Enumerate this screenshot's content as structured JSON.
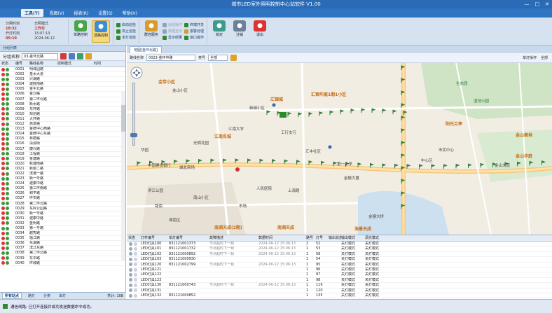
{
  "titlebar": {
    "title": "城市LED室外照明控制中心站软件  V1.00",
    "controls": [
      "—",
      "□",
      "✕"
    ]
  },
  "menus": [
    "工具(T)",
    "视图(V)",
    "报表(R)",
    "设置(S)",
    "帮助(H)"
  ],
  "ribbon": {
    "status": [
      {
        "label": "分闸时刻",
        "value": "18:32"
      },
      {
        "label": "开灯时刻",
        "value": "05:10"
      }
    ],
    "status2": [
      {
        "label": "日照模式",
        "value": "工作日"
      },
      {
        "label": "时间",
        "value": "15:07:13"
      },
      {
        "label": "日期",
        "value": "2024-06-12"
      }
    ],
    "big1": [
      {
        "label": "单路控制",
        "icon": "loop-control-icon",
        "color": "#4aa54a"
      },
      {
        "label": "选路控制",
        "icon": "select-control-icon",
        "color": "#3b8ed6"
      }
    ],
    "small1": [
      {
        "label": "启动巡检",
        "color": "#2f8a2f"
      },
      {
        "label": "停止巡检",
        "color": "#2f8a2f"
      },
      {
        "label": "全灯巡检",
        "color": "#2f8a2f"
      }
    ],
    "big2": [
      {
        "label": "群控服务",
        "icon": "group-service-icon",
        "color": "#d89c2b"
      }
    ],
    "small2": [
      {
        "label": "远程操作",
        "color": "#8ea3bc",
        "disabled": true
      },
      {
        "label": "数据显示",
        "color": "#8ea3bc",
        "disabled": true
      },
      {
        "label": "显示结果",
        "color": "#2f8a2f",
        "disabled": false
      }
    ],
    "small3": [
      {
        "label": "终端开关",
        "color": "#2f8a2f"
      },
      {
        "label": "报警处理",
        "color": "#c9a032"
      },
      {
        "label": "窗口操作",
        "color": "#2f8a2f"
      }
    ],
    "big3": [
      {
        "label": "锁定",
        "icon": "lock-icon",
        "color": "#3d9c8c"
      },
      {
        "label": "注销",
        "icon": "logout-icon",
        "color": "#6d7f99"
      },
      {
        "label": "退出",
        "icon": "power-icon",
        "color": "#d33"
      }
    ]
  },
  "left": {
    "title": "分组列表",
    "filter_label": "分组名称",
    "filter_value": "03-金环北路",
    "columns": [
      "状态",
      "编号",
      "路线名称",
      "控制模式",
      "时间"
    ],
    "rows": [
      [
        "0001",
        "明珠园路"
      ],
      [
        "0002",
        "金水大道"
      ],
      [
        "0003",
        "兴湖路"
      ],
      [
        "0004",
        "建胜南路"
      ],
      [
        "0005",
        "金牛北路"
      ],
      [
        "0006",
        "金沙路"
      ],
      [
        "0007",
        "第二环北路"
      ],
      [
        "0008",
        "新水路"
      ],
      [
        "0009",
        "东环路"
      ],
      [
        "0010",
        "规划路"
      ],
      [
        "0011",
        "大环路"
      ],
      [
        "0012",
        "高景路"
      ],
      [
        "0013",
        "金牌中心西路"
      ],
      [
        "0014",
        "金牌中心东路"
      ],
      [
        "0015",
        "林荫路"
      ],
      [
        "0016",
        "清源街"
      ],
      [
        "0017",
        "康兴路"
      ],
      [
        "0018",
        "工程路"
      ],
      [
        "0019",
        "金塘路"
      ],
      [
        "0020",
        "新塘南路"
      ],
      [
        "0021",
        "新顺二路"
      ],
      [
        "0022",
        "滨港一路"
      ],
      [
        "0023",
        "新一号路"
      ],
      [
        "0024",
        "建康中路"
      ],
      [
        "0025",
        "第三环南路"
      ],
      [
        "0026",
        "和平路"
      ],
      [
        "0027",
        "环市路"
      ],
      [
        "0028",
        "第二环北路"
      ],
      [
        "0029",
        "东岭公园路"
      ],
      [
        "0030",
        "新一号路"
      ],
      [
        "0031",
        "建康中路"
      ],
      [
        "0032",
        "金明路"
      ],
      [
        "0033",
        "第一号路"
      ],
      [
        "0034",
        "越秀路"
      ],
      [
        "0035",
        "临江路"
      ],
      [
        "0036",
        "东湖路"
      ],
      [
        "0037",
        "滨江东路"
      ],
      [
        "0038",
        "第二环北路"
      ],
      [
        "0039",
        "东华路"
      ],
      [
        "0040",
        "环城路"
      ]
    ],
    "tabs": [
      "所有站点",
      "路灯",
      "分类",
      "单灯"
    ],
    "count": "共计: 108"
  },
  "right": {
    "tab": "地图[金环北路]",
    "field1_label": "路线名称",
    "field1_value": "0023-金环中路",
    "field2_label": "类号",
    "field2_value": "全部",
    "toolbar_right": [
      "单灯操作",
      "全部"
    ],
    "map_labels": [
      {
        "t": "金芽小区",
        "c": "orange"
      },
      {
        "t": "汇锦城",
        "c": "orange"
      },
      {
        "t": "汇锦华庭1期1小区",
        "c": "orange"
      },
      {
        "t": "江南名城",
        "c": "orange"
      },
      {
        "t": "阳光兰亭",
        "c": "orange"
      },
      {
        "t": "金山高地",
        "c": "orange"
      },
      {
        "t": "金山华庭",
        "c": "orange"
      },
      {
        "t": "南湖天成(2期)",
        "c": "orange"
      },
      {
        "t": "南湖天成",
        "c": "orange"
      },
      {
        "t": "海景天成",
        "c": "orange"
      },
      {
        "t": "金山小区",
        "c": ""
      },
      {
        "t": "新城小区",
        "c": ""
      },
      {
        "t": "光明花园",
        "c": ""
      },
      {
        "t": "江南大学",
        "c": ""
      },
      {
        "t": "汇丰社区",
        "c": ""
      },
      {
        "t": "工行支行",
        "c": ""
      },
      {
        "t": "市民中心",
        "c": ""
      },
      {
        "t": "城北商场",
        "c": ""
      },
      {
        "t": "华园",
        "c": ""
      },
      {
        "t": "中国建设银行",
        "c": ""
      },
      {
        "t": "金融大厦",
        "c": ""
      },
      {
        "t": "滨江公园",
        "c": ""
      },
      {
        "t": "南山小区",
        "c": ""
      },
      {
        "t": "金山大道",
        "c": ""
      },
      {
        "t": "人民医院",
        "c": ""
      },
      {
        "t": "市场",
        "c": ""
      },
      {
        "t": "第一小学",
        "c": ""
      },
      {
        "t": "路南",
        "c": ""
      },
      {
        "t": "生态园",
        "c": "green"
      },
      {
        "t": "湿地公园",
        "c": "green"
      },
      {
        "t": "上海路",
        "c": ""
      },
      {
        "t": "城南区",
        "c": ""
      },
      {
        "t": "金塘大桥",
        "c": ""
      },
      {
        "t": "中心区",
        "c": ""
      }
    ],
    "grid": {
      "columns": [
        "状态",
        "灯杆编号",
        "单灯编号",
        "故障描述",
        "数据时间",
        "路号",
        "灯号",
        "输出状态",
        "输出模式",
        "调光模式"
      ],
      "rows": [
        [
          "LED灯具100",
          "831121001373",
          "节点超时下一帧",
          "2024-06-12 15:06:13",
          "2",
          "52",
          "关灯模式",
          "关灯模式"
        ],
        [
          "LED灯具101",
          "831121001732",
          "节点超时下一帧",
          "2024-06-12 15:06:13",
          "1",
          "53",
          "关灯模式",
          "关灯模式"
        ],
        [
          "LED灯具102",
          "831121000892",
          "节点超时下一帧",
          "2024-06-12 15:06:13",
          "1",
          "58",
          "关灯模式",
          "关灯模式"
        ],
        [
          "LED灯具103",
          "831121000930",
          "",
          "",
          "1",
          "54",
          "关灯模式",
          "关灯模式"
        ],
        [
          "LED灯具120",
          "831121002799",
          "节点超时下一帧",
          "2024-06-12 15:06:13",
          "1",
          "95",
          "关灯模式",
          "关灯模式"
        ],
        [
          "LED灯具121",
          "",
          "",
          "",
          "1",
          "96",
          "关灯模式",
          "关灯模式"
        ],
        [
          "LED灯具122",
          "",
          "",
          "",
          "1",
          "97",
          "关灯模式",
          "关灯模式"
        ],
        [
          "LED灯具123",
          "",
          "",
          "",
          "1",
          "98",
          "关灯模式",
          "关灯模式"
        ],
        [
          "LED灯具130",
          "831121000743",
          "节点超时下一帧",
          "2024-06-12 15:06:13",
          "1",
          "119",
          "关灯模式",
          "关灯模式"
        ],
        [
          "LED灯具131",
          "",
          "",
          "",
          "1",
          "120",
          "关灯模式",
          "关灯模式"
        ],
        [
          "LED灯具132",
          "831121000852",
          "",
          "",
          "1",
          "135",
          "关灯模式",
          "关灯模式"
        ]
      ]
    }
  },
  "statusbar": {
    "message": "通信线路: 已打开连接并成功发送数据命令成功。"
  }
}
